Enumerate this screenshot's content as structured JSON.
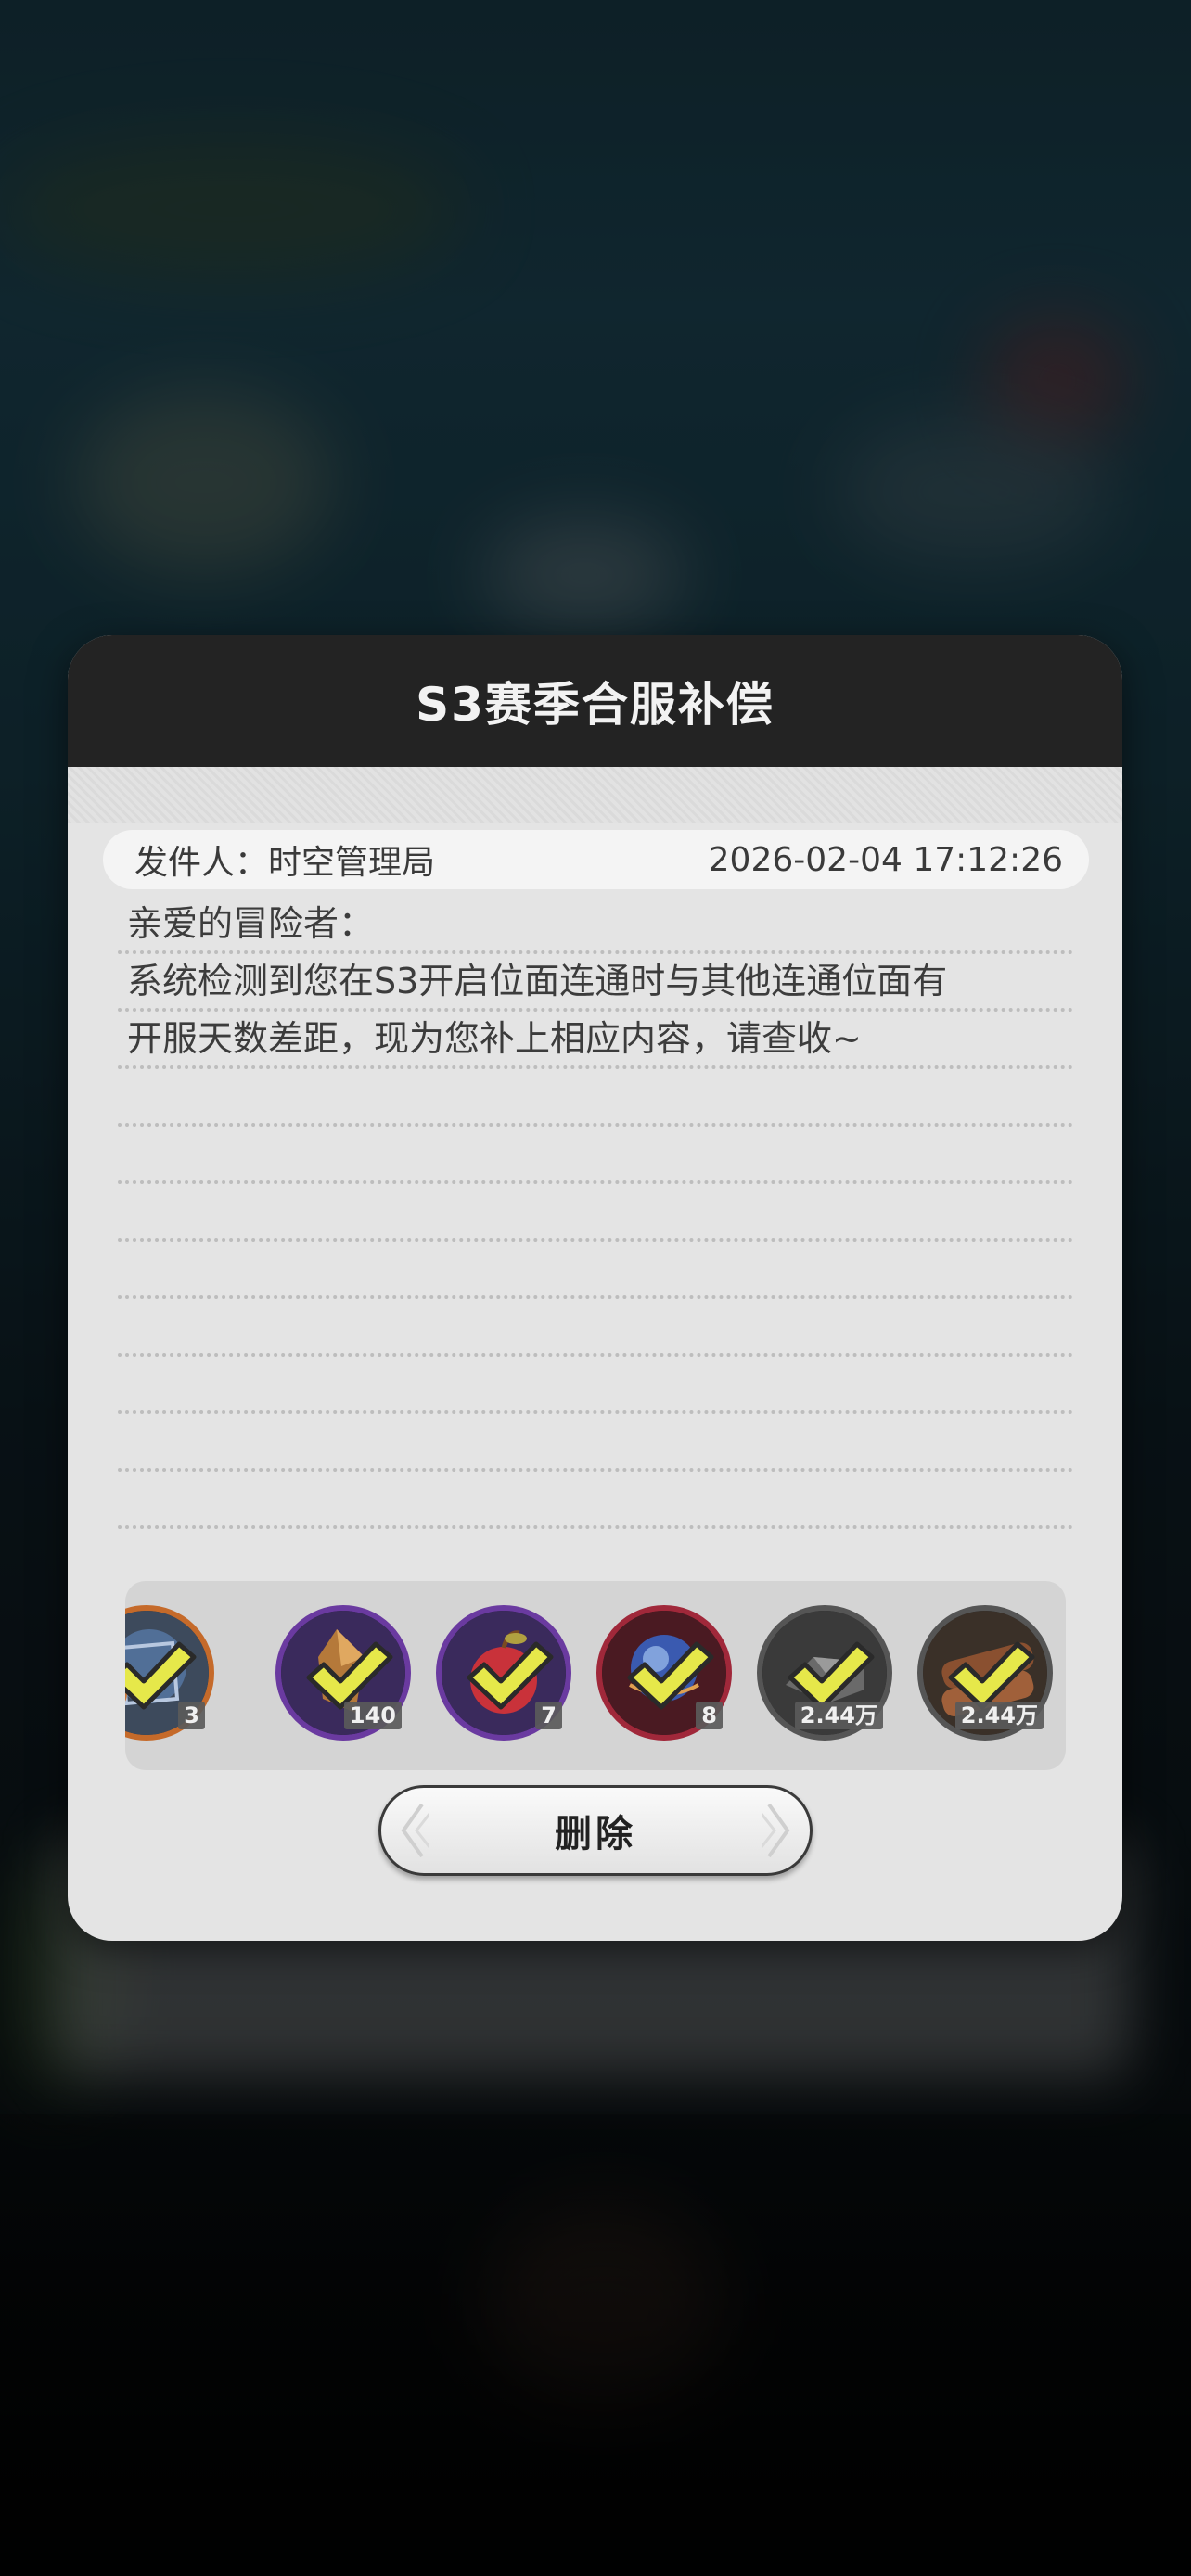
{
  "mail": {
    "title": "S3赛季合服补偿",
    "sender_label": "发件人：",
    "sender_name": "时空管理局",
    "timestamp": "2026-02-04 17:12:26",
    "body_lines": [
      "亲爱的冒险者：",
      "系统检测到您在S3开启位面连通时与其他连通位面有",
      "开服天数差距，现为您补上相应内容，请查收~",
      "",
      "",
      "",
      "",
      "",
      "",
      "",
      ""
    ]
  },
  "rewards": [
    {
      "icon": "orange-relic-icon",
      "count": "3",
      "claimed": true,
      "frame_color": "#c56a2a"
    },
    {
      "icon": "purple-crystal-shard-icon",
      "count": "140",
      "claimed": true,
      "frame_color": "#6a3aa0"
    },
    {
      "icon": "purple-apple-icon",
      "count": "7",
      "claimed": true,
      "frame_color": "#6a3aa0"
    },
    {
      "icon": "red-orb-icon",
      "count": "8",
      "claimed": true,
      "frame_color": "#a0283a"
    },
    {
      "icon": "iron-ore-icon",
      "count": "2.44万",
      "claimed": true,
      "frame_color": "#555555"
    },
    {
      "icon": "wood-log-icon",
      "count": "2.44万",
      "claimed": true,
      "frame_color": "#555555"
    }
  ],
  "actions": {
    "delete_label": "删除"
  },
  "colors": {
    "header_bg": "#232323",
    "panel_bg": "#e4e4e4",
    "check": "#e6e84a"
  }
}
